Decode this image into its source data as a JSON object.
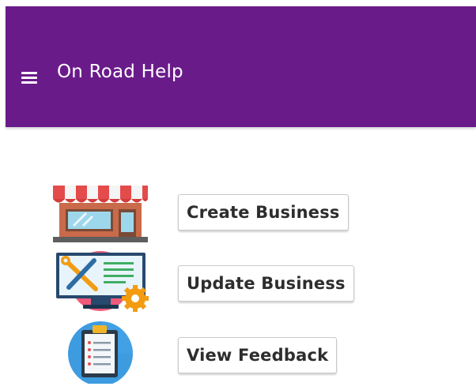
{
  "app_bar": {
    "title": "On Road Help",
    "menu_icon": "hamburger-menu-icon",
    "background_color": "#6a1b8a"
  },
  "menu": {
    "items": [
      {
        "label": "Create Business",
        "icon": "store-icon"
      },
      {
        "label": "Update Business",
        "icon": "monitor-tools-icon"
      },
      {
        "label": "View Feedback",
        "icon": "clipboard-icon"
      }
    ]
  }
}
